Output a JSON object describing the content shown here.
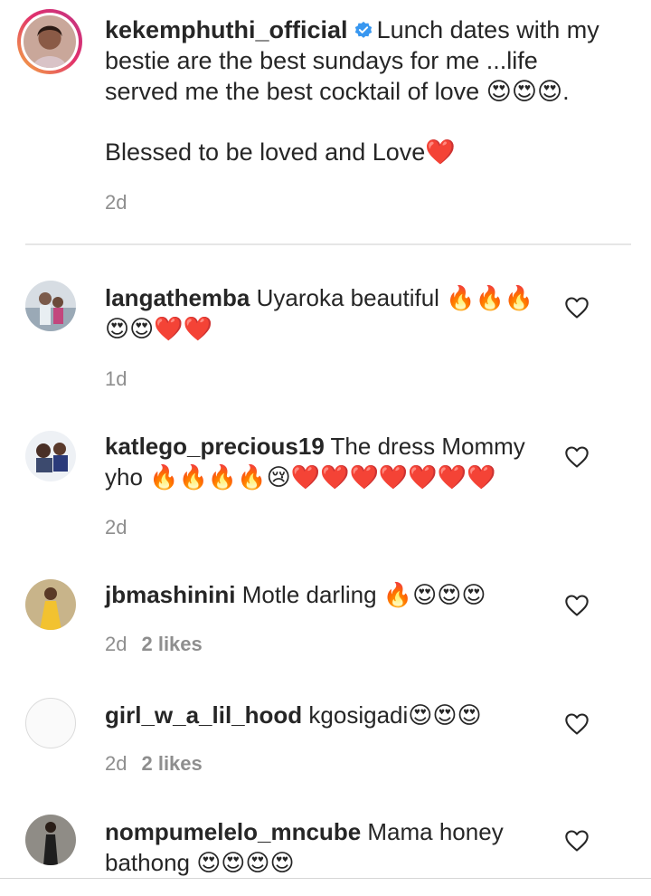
{
  "caption": {
    "username": "kekemphuthi_official",
    "verified_icon": "verified-badge-icon",
    "text": "Lunch dates with my bestie are the best sundays for me ...life served me the best cocktail of love 😍😍😍.",
    "text2": "Blessed to be loved and Love❤️",
    "time": "2d"
  },
  "comments": [
    {
      "username": "langathemba",
      "text": "Uyaroka beautiful 🔥🔥🔥 😍😍❤️❤️",
      "time": "1d",
      "likes": ""
    },
    {
      "username": "katlego_precious19",
      "text": "The dress Mommy yho 🔥🔥🔥🔥😢❤️❤️❤️❤️❤️❤️❤️",
      "time": "2d",
      "likes": ""
    },
    {
      "username": "jbmashinini",
      "text": "Motle darling 🔥😍😍😍",
      "time": "2d",
      "likes": "2 likes"
    },
    {
      "username": "girl_w_a_lil_hood",
      "text": "kgosigadi😍😍😍",
      "time": "2d",
      "likes": "2 likes"
    },
    {
      "username": "nompumelelo_mncube",
      "text": "Mama honey bathong 😍😍😍😍",
      "time": "",
      "likes": ""
    }
  ],
  "icons": {
    "like": "heart-outline-icon"
  },
  "colors": {
    "text": "#262626",
    "secondary": "#8e8e8e",
    "divider": "#e6e6e6",
    "verified": "#3897f0"
  }
}
